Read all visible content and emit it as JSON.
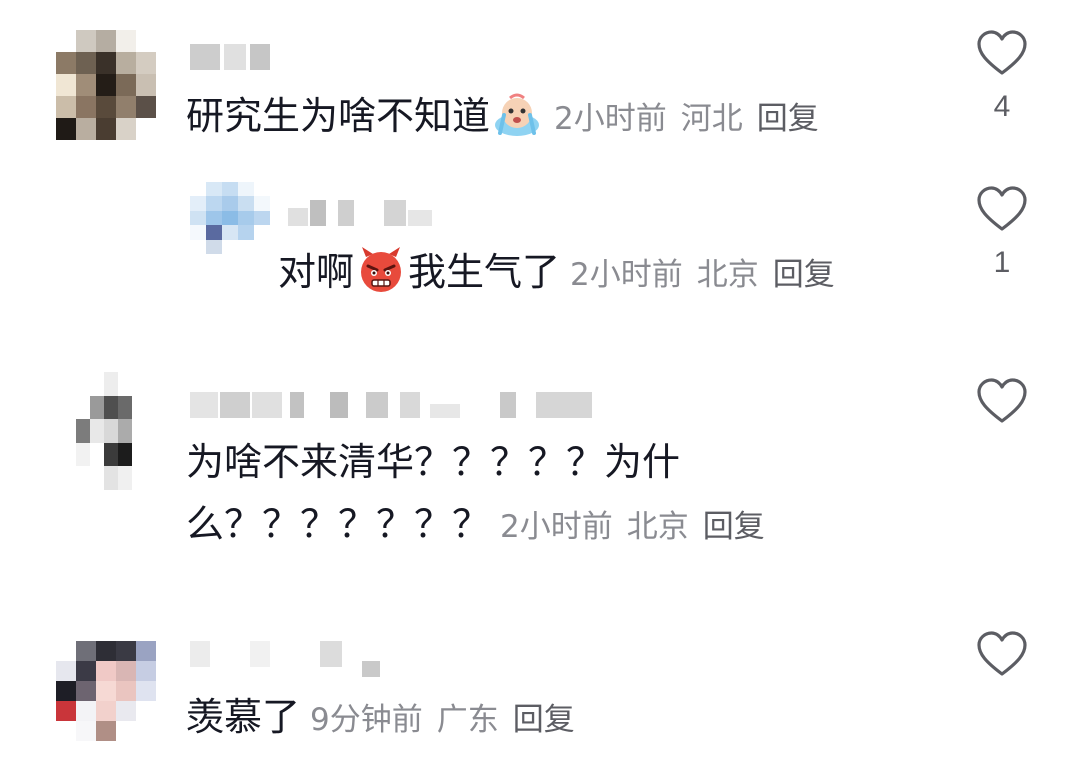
{
  "comments": [
    {
      "text": "研究生为啥不知道",
      "emoji": "crying-face-emoji",
      "time": "2小时前",
      "location": "河北",
      "reply_label": "回复",
      "likes": "4"
    },
    {
      "text_before": "对啊",
      "emoji": "angry-devil-emoji",
      "text_after": "我生气了",
      "time": "2小时前",
      "location": "北京",
      "reply_label": "回复",
      "likes": "1"
    },
    {
      "text_line1": "为啥不来清华？？？？？为什",
      "text_line2": "么？？？？？？？",
      "time": "2小时前",
      "location": "北京",
      "reply_label": "回复",
      "likes": ""
    },
    {
      "text": "羡慕了",
      "time": "9分钟前",
      "location": "广东",
      "reply_label": "回复",
      "likes": ""
    }
  ],
  "icons": {
    "like": "heart-outline-icon"
  },
  "colors": {
    "text": "#161823",
    "meta": "#8a8b91",
    "heart": "#5c5d63"
  }
}
